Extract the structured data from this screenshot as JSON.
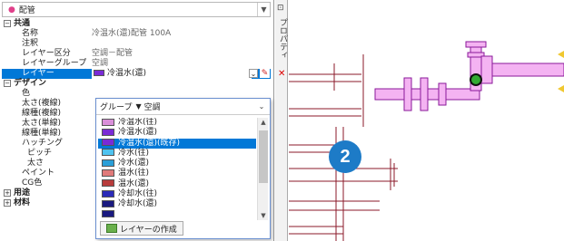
{
  "panel": {
    "title": "配管",
    "rows": [
      {
        "type": "section",
        "label": "共通",
        "toggle": "−"
      },
      {
        "label": "名称",
        "value": "冷温水(還)配管 100A"
      },
      {
        "label": "注釈",
        "value": ""
      },
      {
        "label": "レイヤー区分",
        "value": "空調－配管"
      },
      {
        "label": "レイヤーグループ",
        "value": "空調"
      },
      {
        "label": "レイヤー",
        "value": "冷温水(還)",
        "selected": true,
        "color": "#7a2bd6"
      },
      {
        "type": "section",
        "label": "デザイン",
        "toggle": "−"
      },
      {
        "label": "色",
        "value": ""
      },
      {
        "label": "太さ(複線)",
        "value": ""
      },
      {
        "label": "線種(複線)",
        "value": ""
      },
      {
        "label": "太さ(単線)",
        "value": ""
      },
      {
        "label": "線種(単線)",
        "value": ""
      },
      {
        "label": "ハッチング",
        "value": ""
      },
      {
        "label": "ピッチ",
        "value": "",
        "sub": true
      },
      {
        "label": "太さ",
        "value": "",
        "sub": true
      },
      {
        "label": "ペイント",
        "value": ""
      },
      {
        "label": "CG色",
        "value": ""
      },
      {
        "type": "section",
        "label": "用途",
        "toggle": "+"
      },
      {
        "type": "section",
        "label": "材料",
        "toggle": "+"
      }
    ]
  },
  "sidebar": {
    "vertical_label": "プロパティ"
  },
  "popup": {
    "group_label": "グループ",
    "group_value": "空調",
    "items": [
      {
        "label": "冷温水(往)",
        "color": "#d98fd9"
      },
      {
        "label": "冷温水(還)",
        "color": "#7a2bd6"
      },
      {
        "label": "冷温水(還)(既存)",
        "color": "#7a2bd6",
        "highlight": true
      },
      {
        "label": "冷水(往)",
        "color": "#4fc3f0"
      },
      {
        "label": "冷水(還)",
        "color": "#2a9fd8"
      },
      {
        "label": "温水(往)",
        "color": "#e07a7a"
      },
      {
        "label": "温水(還)",
        "color": "#b83c3c"
      },
      {
        "label": "冷却水(往)",
        "color": "#2a2ab8"
      },
      {
        "label": "冷却水(還)",
        "color": "#1a1a80"
      },
      {
        "label": "",
        "color": "#1a1a80"
      }
    ],
    "create_button": "レイヤーの作成"
  },
  "badge": "2"
}
